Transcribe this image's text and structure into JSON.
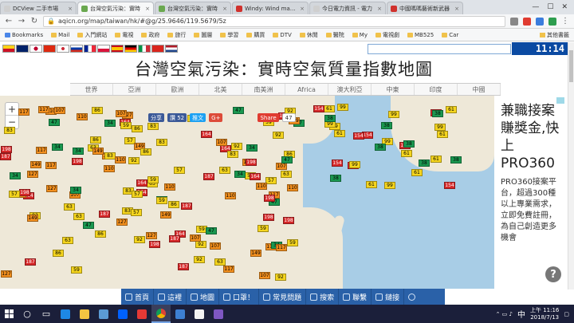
{
  "browser": {
    "tabs": [
      {
        "title": "DCView 二手市場",
        "color": "#e8e8e8",
        "active": false
      },
      {
        "title": "台灣空氣污染：實時",
        "color": "#6aa84f",
        "active": true
      },
      {
        "title": "台灣空氣污染：實時",
        "color": "#6aa84f",
        "active": false
      },
      {
        "title": "Windy: Wind map &",
        "color": "#d0312d",
        "active": false
      },
      {
        "title": "今日電力資訊 - 電力",
        "color": "#e8e8e8",
        "active": false
      },
      {
        "title": "中國嗎嗎藝術新武器",
        "color": "#d0312d",
        "active": false
      }
    ],
    "url": "aqicn.org/map/taiwan/hk/#@g/25.9646/119.5679/5z",
    "bookmarks": [
      "Bookmarks",
      "Mail",
      "入門網站",
      "電視",
      "政府",
      "旅行",
      "圖層",
      "學習",
      "購買",
      "DTV",
      "休閒",
      "醫院",
      "My",
      "電視劇",
      "MB525",
      "Car"
    ],
    "bookmarks_other": "其他書籤"
  },
  "site": {
    "clock": "11:14",
    "headline": "台灣空氣污染：實時空氣質量指數地圖",
    "regions": [
      "世界",
      "亞洲",
      "歐洲",
      "北美",
      "南美洲",
      "Africa",
      "澳大利亞",
      "中東",
      "印度",
      "中國"
    ],
    "social": {
      "share": "分享",
      "like_count": "讚 52",
      "tweet": "推文",
      "gplus": "G+",
      "share_count_label": "Share",
      "share_count": "47"
    },
    "map_labels": {
      "zoom_in": "+",
      "zoom_out": "−"
    },
    "ad": {
      "headline": "兼職接案賺獎金,快上PRO360",
      "body": "PRO360接案平台，超過300種以上專業需求，立即免費註冊，為自己創造更多機會",
      "help": "?"
    },
    "bottom_nav": [
      "首頁",
      "這裡",
      "地圖",
      "口罩！",
      "常見問題",
      "搜索",
      "聯繫",
      "鏈接"
    ]
  },
  "markers": [
    {
      "v": "99",
      "c": "#f5d51e"
    },
    {
      "v": "164",
      "c": "#d62728"
    },
    {
      "v": "83",
      "c": "#f5d51e"
    },
    {
      "v": "92",
      "c": "#f5d51e"
    },
    {
      "v": "107",
      "c": "#f28f1e"
    },
    {
      "v": "154",
      "c": "#d62728"
    },
    {
      "v": "187",
      "c": "#d62728"
    },
    {
      "v": "86",
      "c": "#f5d51e"
    },
    {
      "v": "57",
      "c": "#f5d51e"
    },
    {
      "v": "47",
      "c": "#1a9850"
    },
    {
      "v": "38",
      "c": "#1a9850"
    },
    {
      "v": "117",
      "c": "#f28f1e"
    },
    {
      "v": "110",
      "c": "#f28f1e"
    },
    {
      "v": "59",
      "c": "#f5d51e"
    },
    {
      "v": "34",
      "c": "#1a9850"
    },
    {
      "v": "61",
      "c": "#f5d51e"
    },
    {
      "v": "149",
      "c": "#f28f1e"
    },
    {
      "v": "127",
      "c": "#f28f1e"
    },
    {
      "v": "198",
      "c": "#d62728"
    },
    {
      "v": "63",
      "c": "#f5d51e"
    }
  ],
  "taskbar": {
    "time": "上午 11:16",
    "date": "2018/7/13",
    "ime": "中"
  }
}
